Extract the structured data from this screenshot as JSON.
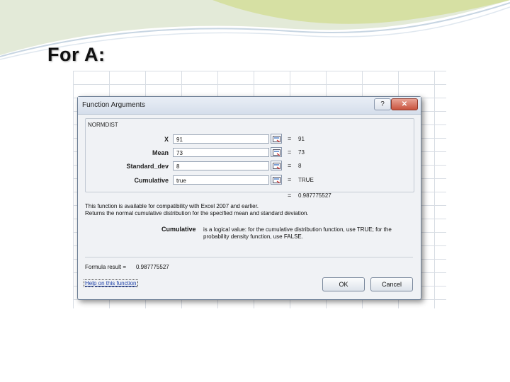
{
  "slide": {
    "title": "For A:"
  },
  "dialog": {
    "title": "Function Arguments",
    "help_button": "?",
    "close_button": "✕",
    "function_name": "NORMDIST",
    "args": [
      {
        "label": "X",
        "value": "91",
        "result": "91"
      },
      {
        "label": "Mean",
        "value": "73",
        "result": "73"
      },
      {
        "label": "Standard_dev",
        "value": "8",
        "result": "8"
      },
      {
        "label": "Cumulative",
        "value": "true",
        "result": "TRUE"
      }
    ],
    "equals": "=",
    "function_result": "0.987775527",
    "description_line1": "This function is available for compatibility with Excel 2007 and earlier.",
    "description_line2": "Returns the normal cumulative distribution for the specified mean and standard deviation.",
    "arg_help_name": "Cumulative",
    "arg_help_line1": "is a logical value: for the cumulative distribution function, use TRUE; for the",
    "arg_help_line2": "probability density function, use FALSE.",
    "formula_result_label": "Formula result =",
    "formula_result_value": "0.987775527",
    "help_link": "Help on this function",
    "ok_label": "OK",
    "cancel_label": "Cancel"
  }
}
